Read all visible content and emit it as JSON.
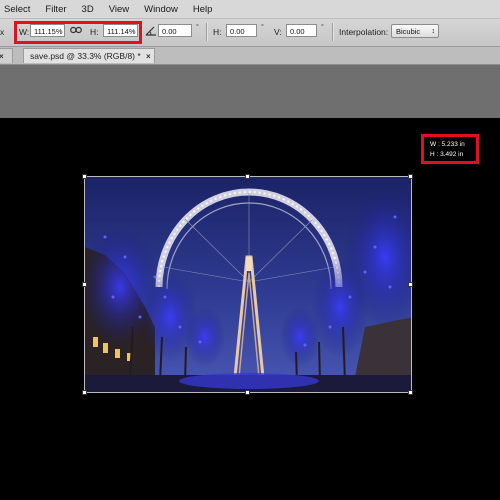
{
  "menu": {
    "items": [
      "Select",
      "Filter",
      "3D",
      "View",
      "Window",
      "Help"
    ]
  },
  "options": {
    "left_edge_glyph": "x",
    "w_label": "W:",
    "w_value": "111.15%",
    "link_icon": "chain-link-icon",
    "h_label": "H:",
    "h_value": "111.14%",
    "angle_icon": "rotate-angle-icon",
    "angle_value": "0.00",
    "angle_unit": "°",
    "hskew_label": "H:",
    "hskew_value": "0.00",
    "hskew_unit": "°",
    "vskew_label": "V:",
    "vskew_value": "0.00",
    "vskew_unit": "°",
    "interp_label": "Interpolation:",
    "interp_value": "Bicubic"
  },
  "tabs": {
    "left_stub_close": "×",
    "doc_title": "save.psd @ 33.3% (RGB/8) *",
    "doc_close": "×"
  },
  "info": {
    "w_line": "W :   5.233 in",
    "h_line": "H :   3.492 in"
  },
  "colors": {
    "highlight_red": "#e01020",
    "canvas_black": "#000000",
    "pasteboard_gray": "#6f6f6f"
  }
}
